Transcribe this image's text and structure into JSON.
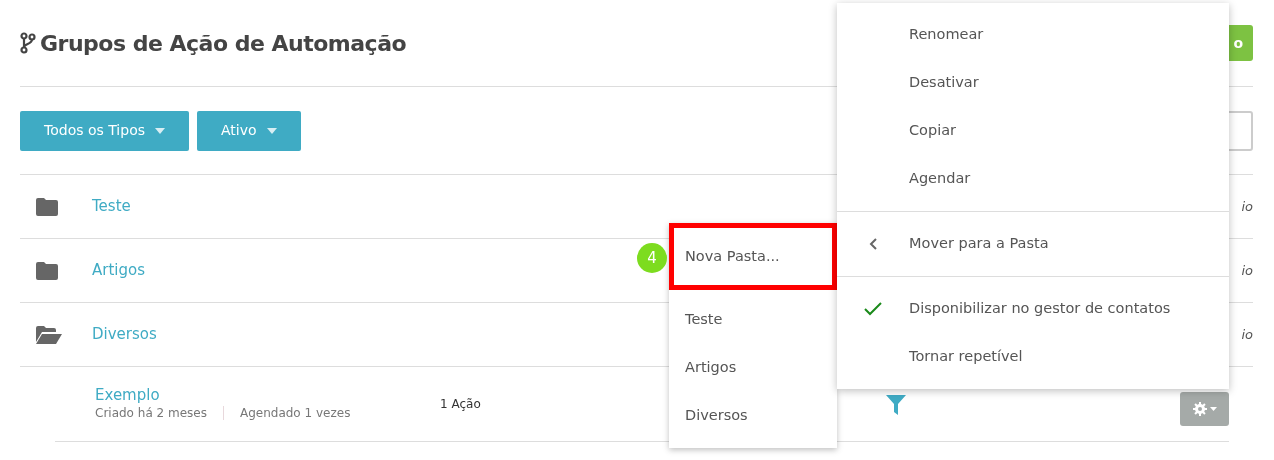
{
  "header": {
    "title": "Grupos de Ação de Automação",
    "button_label": "o"
  },
  "filters": [
    {
      "label": "Todos os Tipos"
    },
    {
      "label": "Ativo"
    }
  ],
  "folders": [
    {
      "name": "Teste",
      "open": false,
      "column_right": "io"
    },
    {
      "name": "Artigos",
      "open": false,
      "column_right": "io"
    },
    {
      "name": "Diversos",
      "open": true,
      "column_right": "io"
    }
  ],
  "items": [
    {
      "name": "Exemplo",
      "created": "Criado há 2 meses",
      "scheduled": "Agendado 1 vezes",
      "actions": "1 Ação"
    }
  ],
  "context_menu": {
    "sections": [
      [
        {
          "kind": "item",
          "label": "Renomear"
        },
        {
          "kind": "item",
          "label": "Desativar"
        },
        {
          "kind": "item",
          "label": "Copiar"
        },
        {
          "kind": "item",
          "label": "Agendar"
        }
      ],
      [
        {
          "kind": "submenu",
          "label": "Mover para a Pasta",
          "expanded": true
        }
      ],
      [
        {
          "kind": "toggle",
          "label": "Disponibilizar no gestor de contatos",
          "checked": true
        },
        {
          "kind": "toggle",
          "label": "Tornar repetível",
          "checked": false
        }
      ]
    ]
  },
  "submenu": {
    "items": [
      {
        "label": "Nova Pasta...",
        "highlighted": true
      },
      {
        "label": "Teste",
        "highlighted": false
      },
      {
        "label": "Artigos",
        "highlighted": false
      },
      {
        "label": "Diversos",
        "highlighted": false
      }
    ],
    "step_badge": "4"
  }
}
